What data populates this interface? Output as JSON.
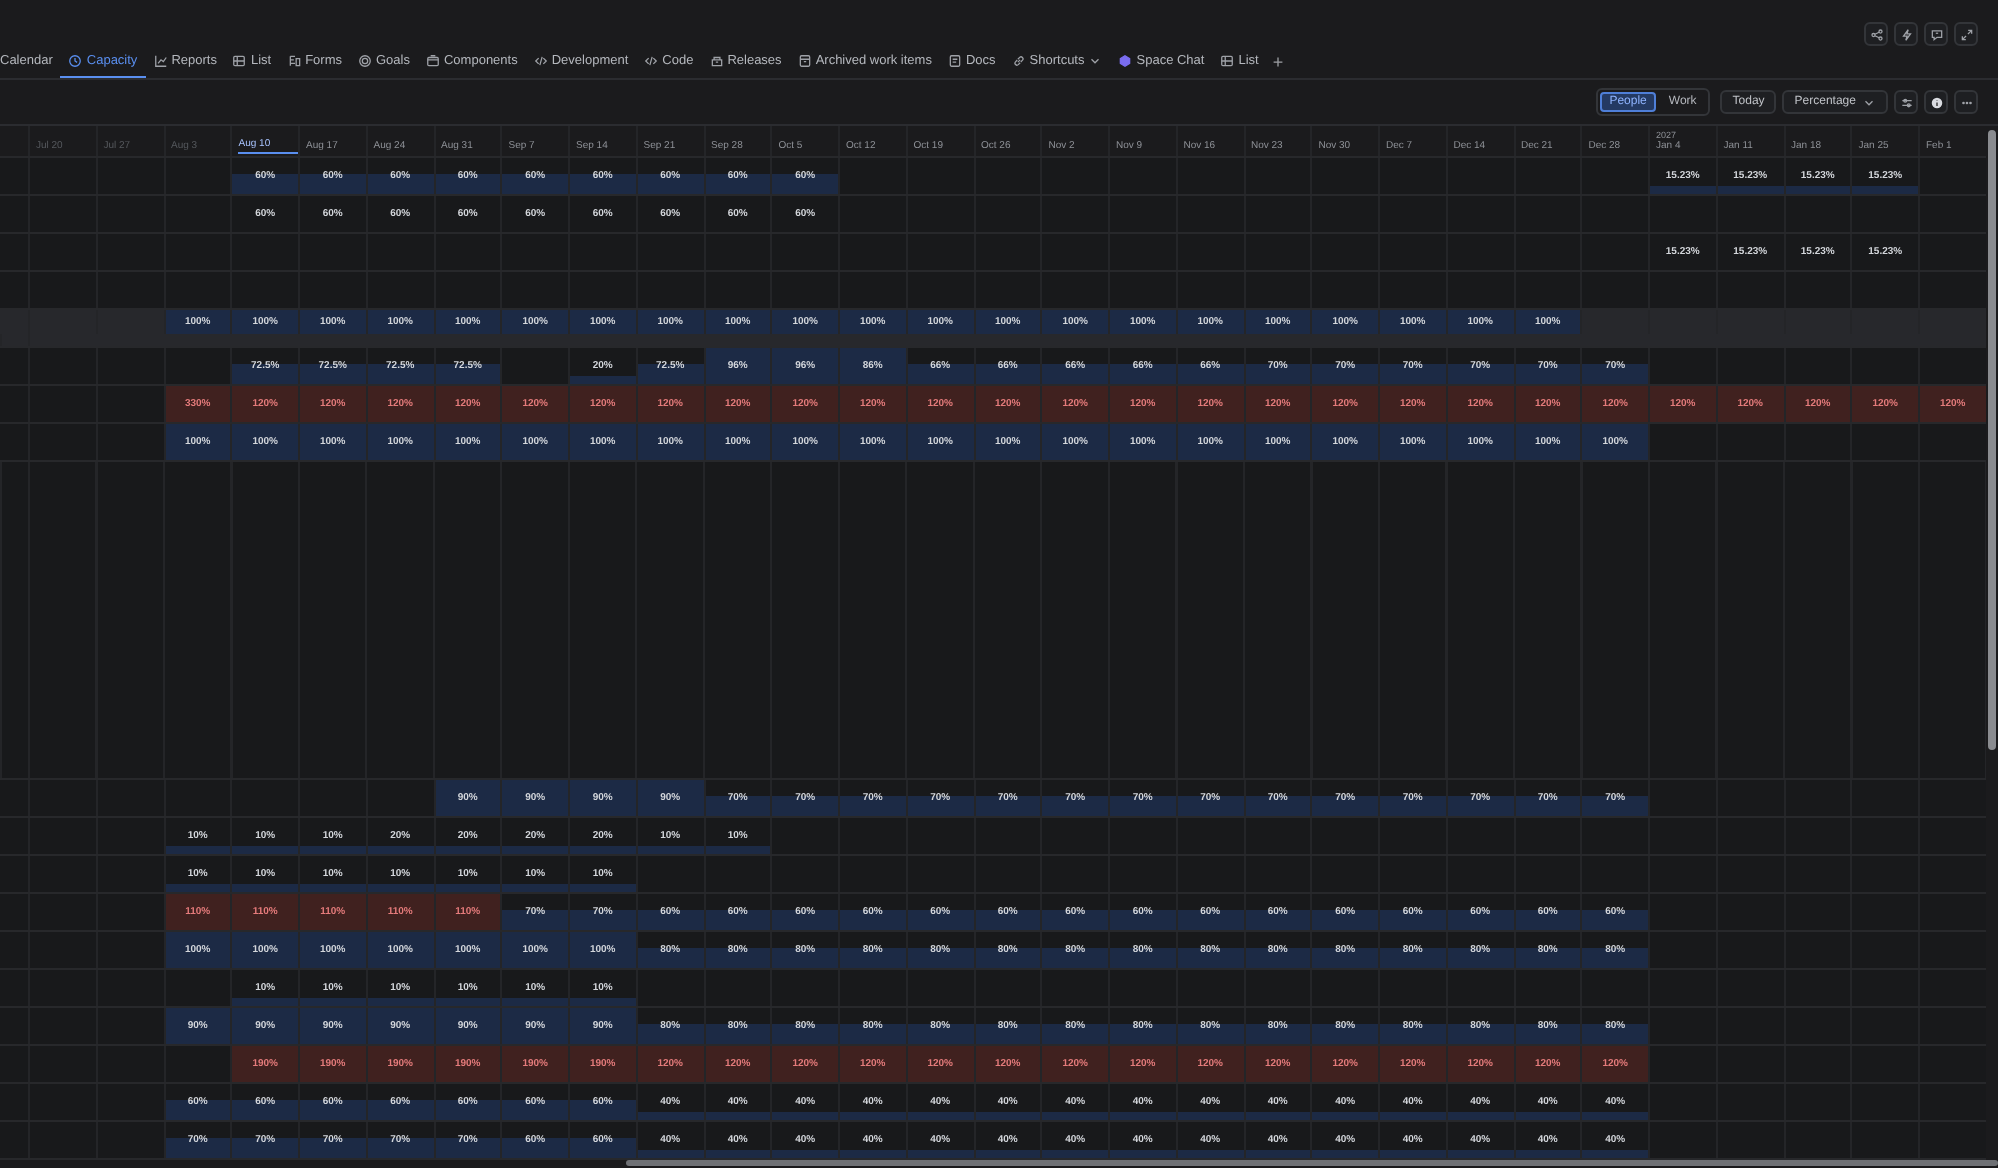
{
  "tabs": [
    {
      "label": "Calendar",
      "kind": "none",
      "selected": false,
      "dropdown": false
    },
    {
      "label": "Capacity",
      "kind": "clock",
      "selected": true,
      "dropdown": false
    },
    {
      "label": "Reports",
      "kind": "chart",
      "selected": false,
      "dropdown": false
    },
    {
      "label": "List",
      "kind": "table",
      "selected": false,
      "dropdown": false
    },
    {
      "label": "Forms",
      "kind": "forms",
      "selected": false,
      "dropdown": false
    },
    {
      "label": "Goals",
      "kind": "target",
      "selected": false,
      "dropdown": false
    },
    {
      "label": "Components",
      "kind": "box",
      "selected": false,
      "dropdown": false
    },
    {
      "label": "Development",
      "kind": "code",
      "selected": false,
      "dropdown": false
    },
    {
      "label": "Code",
      "kind": "code",
      "selected": false,
      "dropdown": false
    },
    {
      "label": "Releases",
      "kind": "package",
      "selected": false,
      "dropdown": false
    },
    {
      "label": "Archived work items",
      "kind": "archive",
      "selected": false,
      "dropdown": false
    },
    {
      "label": "Docs",
      "kind": "doc",
      "selected": false,
      "dropdown": false
    },
    {
      "label": "Shortcuts",
      "kind": "link",
      "selected": false,
      "dropdown": true
    },
    {
      "label": "Space Chat",
      "kind": "chat",
      "selected": false,
      "dropdown": false
    },
    {
      "label": "List",
      "kind": "table",
      "selected": false,
      "dropdown": false
    }
  ],
  "add_tab": "+",
  "toolbar": {
    "view_toggle": [
      {
        "label": "People",
        "selected": true
      },
      {
        "label": "Work",
        "selected": false
      }
    ],
    "today": "Today",
    "unit": "Percentage"
  },
  "weeks": [
    {
      "label": "Jul 20",
      "kind": "past"
    },
    {
      "label": "Jul 27",
      "kind": "past"
    },
    {
      "label": "Aug 3",
      "kind": "past"
    },
    {
      "label": "Aug 10",
      "kind": "current"
    },
    {
      "label": "Aug 17",
      "kind": "future"
    },
    {
      "label": "Aug 24",
      "kind": "future"
    },
    {
      "label": "Aug 31",
      "kind": "future"
    },
    {
      "label": "Sep 7",
      "kind": "future"
    },
    {
      "label": "Sep 14",
      "kind": "future"
    },
    {
      "label": "Sep 21",
      "kind": "future"
    },
    {
      "label": "Sep 28",
      "kind": "future"
    },
    {
      "label": "Oct 5",
      "kind": "future"
    },
    {
      "label": "Oct 12",
      "kind": "future"
    },
    {
      "label": "Oct 19",
      "kind": "future"
    },
    {
      "label": "Oct 26",
      "kind": "future"
    },
    {
      "label": "Nov 2",
      "kind": "future"
    },
    {
      "label": "Nov 9",
      "kind": "future"
    },
    {
      "label": "Nov 16",
      "kind": "future"
    },
    {
      "label": "Nov 23",
      "kind": "future"
    },
    {
      "label": "Nov 30",
      "kind": "future"
    },
    {
      "label": "Dec 7",
      "kind": "future"
    },
    {
      "label": "Dec 14",
      "kind": "future"
    },
    {
      "label": "Dec 21",
      "kind": "future"
    },
    {
      "label": "Dec 28",
      "kind": "future"
    },
    {
      "label": "Jan 4",
      "kind": "future",
      "year": "2027"
    },
    {
      "label": "Jan 11",
      "kind": "future"
    },
    {
      "label": "Jan 18",
      "kind": "future"
    },
    {
      "label": "Jan 25",
      "kind": "future"
    },
    {
      "label": "Feb 1",
      "kind": "future"
    }
  ],
  "upper_rows": [
    {
      "selected": false,
      "cells": [
        null,
        null,
        null,
        {
          "value": "60%",
          "kind": "bar"
        },
        {
          "value": "60%",
          "kind": "bar"
        },
        {
          "value": "60%",
          "kind": "bar"
        },
        {
          "value": "60%",
          "kind": "bar"
        },
        {
          "value": "60%",
          "kind": "bar"
        },
        {
          "value": "60%",
          "kind": "bar"
        },
        {
          "value": "60%",
          "kind": "bar"
        },
        {
          "value": "60%",
          "kind": "bar"
        },
        {
          "value": "60%",
          "kind": "bar"
        },
        null,
        null,
        null,
        null,
        null,
        null,
        null,
        null,
        null,
        null,
        null,
        null,
        {
          "value": "15.23%",
          "kind": "low"
        },
        {
          "value": "15.23%",
          "kind": "low"
        },
        {
          "value": "15.23%",
          "kind": "low"
        },
        {
          "value": "15.23%",
          "kind": "low"
        },
        null
      ]
    },
    {
      "selected": false,
      "cells": [
        null,
        null,
        null,
        {
          "value": "60%",
          "kind": "plain"
        },
        {
          "value": "60%",
          "kind": "plain"
        },
        {
          "value": "60%",
          "kind": "plain"
        },
        {
          "value": "60%",
          "kind": "plain"
        },
        {
          "value": "60%",
          "kind": "plain"
        },
        {
          "value": "60%",
          "kind": "plain"
        },
        {
          "value": "60%",
          "kind": "plain"
        },
        {
          "value": "60%",
          "kind": "plain"
        },
        {
          "value": "60%",
          "kind": "plain"
        },
        null,
        null,
        null,
        null,
        null,
        null,
        null,
        null,
        null,
        null,
        null,
        null,
        null,
        null,
        null,
        null,
        null
      ]
    },
    {
      "selected": false,
      "cells": [
        null,
        null,
        null,
        null,
        null,
        null,
        null,
        null,
        null,
        null,
        null,
        null,
        null,
        null,
        null,
        null,
        null,
        null,
        null,
        null,
        null,
        null,
        null,
        null,
        {
          "value": "15.23%",
          "kind": "plain"
        },
        {
          "value": "15.23%",
          "kind": "plain"
        },
        {
          "value": "15.23%",
          "kind": "plain"
        },
        {
          "value": "15.23%",
          "kind": "plain"
        },
        null
      ]
    },
    {
      "selected": false,
      "cells": [
        null,
        null,
        null,
        null,
        null,
        null,
        null,
        null,
        null,
        null,
        null,
        null,
        null,
        null,
        null,
        null,
        null,
        null,
        null,
        null,
        null,
        null,
        null,
        null,
        null,
        null,
        null,
        null,
        null
      ]
    },
    {
      "selected": true,
      "cells": [
        null,
        null,
        {
          "value": "100%",
          "kind": "full"
        },
        {
          "value": "100%",
          "kind": "full"
        },
        {
          "value": "100%",
          "kind": "full"
        },
        {
          "value": "100%",
          "kind": "full"
        },
        {
          "value": "100%",
          "kind": "full"
        },
        {
          "value": "100%",
          "kind": "full"
        },
        {
          "value": "100%",
          "kind": "full"
        },
        {
          "value": "100%",
          "kind": "full"
        },
        {
          "value": "100%",
          "kind": "full"
        },
        {
          "value": "100%",
          "kind": "full"
        },
        {
          "value": "100%",
          "kind": "full"
        },
        {
          "value": "100%",
          "kind": "full"
        },
        {
          "value": "100%",
          "kind": "full"
        },
        {
          "value": "100%",
          "kind": "full"
        },
        {
          "value": "100%",
          "kind": "full"
        },
        {
          "value": "100%",
          "kind": "full"
        },
        {
          "value": "100%",
          "kind": "full"
        },
        {
          "value": "100%",
          "kind": "full"
        },
        {
          "value": "100%",
          "kind": "full"
        },
        {
          "value": "100%",
          "kind": "full"
        },
        {
          "value": "100%",
          "kind": "full"
        },
        null,
        null,
        null,
        null,
        null,
        null,
        null,
        null
      ]
    },
    {
      "selected": false,
      "cells": [
        null,
        null,
        null,
        {
          "value": "72.5%",
          "kind": "bar"
        },
        {
          "value": "72.5%",
          "kind": "bar"
        },
        {
          "value": "72.5%",
          "kind": "bar"
        },
        {
          "value": "72.5%",
          "kind": "bar"
        },
        null,
        {
          "value": "20%",
          "kind": "low"
        },
        {
          "value": "72.5%",
          "kind": "bar"
        },
        {
          "value": "96%",
          "kind": "full"
        },
        {
          "value": "96%",
          "kind": "full"
        },
        {
          "value": "86%",
          "kind": "full"
        },
        {
          "value": "66%",
          "kind": "bar"
        },
        {
          "value": "66%",
          "kind": "bar"
        },
        {
          "value": "66%",
          "kind": "bar"
        },
        {
          "value": "66%",
          "kind": "bar"
        },
        {
          "value": "66%",
          "kind": "bar"
        },
        {
          "value": "70%",
          "kind": "bar"
        },
        {
          "value": "70%",
          "kind": "bar"
        },
        {
          "value": "70%",
          "kind": "bar"
        },
        {
          "value": "70%",
          "kind": "bar"
        },
        {
          "value": "70%",
          "kind": "bar"
        },
        {
          "value": "70%",
          "kind": "bar"
        },
        null,
        null,
        null,
        null,
        null
      ]
    },
    {
      "selected": false,
      "cells": [
        null,
        null,
        {
          "value": "330%",
          "kind": "over"
        },
        {
          "value": "120%",
          "kind": "over"
        },
        {
          "value": "120%",
          "kind": "over"
        },
        {
          "value": "120%",
          "kind": "over"
        },
        {
          "value": "120%",
          "kind": "over"
        },
        {
          "value": "120%",
          "kind": "over"
        },
        {
          "value": "120%",
          "kind": "over"
        },
        {
          "value": "120%",
          "kind": "over"
        },
        {
          "value": "120%",
          "kind": "over"
        },
        {
          "value": "120%",
          "kind": "over"
        },
        {
          "value": "120%",
          "kind": "over"
        },
        {
          "value": "120%",
          "kind": "over"
        },
        {
          "value": "120%",
          "kind": "over"
        },
        {
          "value": "120%",
          "kind": "over"
        },
        {
          "value": "120%",
          "kind": "over"
        },
        {
          "value": "120%",
          "kind": "over"
        },
        {
          "value": "120%",
          "kind": "over"
        },
        {
          "value": "120%",
          "kind": "over"
        },
        {
          "value": "120%",
          "kind": "over"
        },
        {
          "value": "120%",
          "kind": "over"
        },
        {
          "value": "120%",
          "kind": "over"
        },
        {
          "value": "120%",
          "kind": "over"
        },
        {
          "value": "120%",
          "kind": "over"
        },
        {
          "value": "120%",
          "kind": "over"
        },
        {
          "value": "120%",
          "kind": "over"
        },
        {
          "value": "120%",
          "kind": "over"
        },
        {
          "value": "120%",
          "kind": "over"
        }
      ]
    },
    {
      "selected": false,
      "cells": [
        null,
        null,
        {
          "value": "100%",
          "kind": "full"
        },
        {
          "value": "100%",
          "kind": "full"
        },
        {
          "value": "100%",
          "kind": "full"
        },
        {
          "value": "100%",
          "kind": "full"
        },
        {
          "value": "100%",
          "kind": "full"
        },
        {
          "value": "100%",
          "kind": "full"
        },
        {
          "value": "100%",
          "kind": "full"
        },
        {
          "value": "100%",
          "kind": "full"
        },
        {
          "value": "100%",
          "kind": "full"
        },
        {
          "value": "100%",
          "kind": "full"
        },
        {
          "value": "100%",
          "kind": "full"
        },
        {
          "value": "100%",
          "kind": "full"
        },
        {
          "value": "100%",
          "kind": "full"
        },
        {
          "value": "100%",
          "kind": "full"
        },
        {
          "value": "100%",
          "kind": "full"
        },
        {
          "value": "100%",
          "kind": "full"
        },
        {
          "value": "100%",
          "kind": "full"
        },
        {
          "value": "100%",
          "kind": "full"
        },
        {
          "value": "100%",
          "kind": "full"
        },
        {
          "value": "100%",
          "kind": "full"
        },
        {
          "value": "100%",
          "kind": "full"
        },
        {
          "value": "100%",
          "kind": "full"
        },
        null,
        null,
        null,
        null,
        null
      ]
    }
  ],
  "lower_rows": [
    {
      "selected": false,
      "cells": [
        null,
        null,
        null,
        null,
        null,
        null,
        {
          "value": "90%",
          "kind": "full"
        },
        {
          "value": "90%",
          "kind": "full"
        },
        {
          "value": "90%",
          "kind": "full"
        },
        {
          "value": "90%",
          "kind": "full"
        },
        {
          "value": "70%",
          "kind": "bar"
        },
        {
          "value": "70%",
          "kind": "bar"
        },
        {
          "value": "70%",
          "kind": "bar"
        },
        {
          "value": "70%",
          "kind": "bar"
        },
        {
          "value": "70%",
          "kind": "bar"
        },
        {
          "value": "70%",
          "kind": "bar"
        },
        {
          "value": "70%",
          "kind": "bar"
        },
        {
          "value": "70%",
          "kind": "bar"
        },
        {
          "value": "70%",
          "kind": "bar"
        },
        {
          "value": "70%",
          "kind": "bar"
        },
        {
          "value": "70%",
          "kind": "bar"
        },
        {
          "value": "70%",
          "kind": "bar"
        },
        {
          "value": "70%",
          "kind": "bar"
        },
        {
          "value": "70%",
          "kind": "bar"
        },
        null,
        null,
        null,
        null,
        null
      ]
    },
    {
      "selected": false,
      "cells": [
        null,
        null,
        {
          "value": "10%",
          "kind": "low"
        },
        {
          "value": "10%",
          "kind": "low"
        },
        {
          "value": "10%",
          "kind": "low"
        },
        {
          "value": "20%",
          "kind": "low"
        },
        {
          "value": "20%",
          "kind": "low"
        },
        {
          "value": "20%",
          "kind": "low"
        },
        {
          "value": "20%",
          "kind": "low"
        },
        {
          "value": "10%",
          "kind": "low"
        },
        {
          "value": "10%",
          "kind": "low"
        },
        null,
        null,
        null,
        null,
        null,
        null,
        null,
        null,
        null,
        null,
        null,
        null,
        null,
        null,
        null,
        null,
        null,
        null
      ]
    },
    {
      "selected": false,
      "cells": [
        null,
        null,
        {
          "value": "10%",
          "kind": "low"
        },
        {
          "value": "10%",
          "kind": "low"
        },
        {
          "value": "10%",
          "kind": "low"
        },
        {
          "value": "10%",
          "kind": "low"
        },
        {
          "value": "10%",
          "kind": "low"
        },
        {
          "value": "10%",
          "kind": "low"
        },
        {
          "value": "10%",
          "kind": "low"
        },
        null,
        null,
        null,
        null,
        null,
        null,
        null,
        null,
        null,
        null,
        null,
        null,
        null,
        null,
        null,
        null,
        null,
        null,
        null,
        null
      ]
    },
    {
      "selected": false,
      "cells": [
        null,
        null,
        {
          "value": "110%",
          "kind": "over"
        },
        {
          "value": "110%",
          "kind": "over"
        },
        {
          "value": "110%",
          "kind": "over"
        },
        {
          "value": "110%",
          "kind": "over"
        },
        {
          "value": "110%",
          "kind": "over"
        },
        {
          "value": "70%",
          "kind": "bar"
        },
        {
          "value": "70%",
          "kind": "bar"
        },
        {
          "value": "60%",
          "kind": "bar"
        },
        {
          "value": "60%",
          "kind": "bar"
        },
        {
          "value": "60%",
          "kind": "bar"
        },
        {
          "value": "60%",
          "kind": "bar"
        },
        {
          "value": "60%",
          "kind": "bar"
        },
        {
          "value": "60%",
          "kind": "bar"
        },
        {
          "value": "60%",
          "kind": "bar"
        },
        {
          "value": "60%",
          "kind": "bar"
        },
        {
          "value": "60%",
          "kind": "bar"
        },
        {
          "value": "60%",
          "kind": "bar"
        },
        {
          "value": "60%",
          "kind": "bar"
        },
        {
          "value": "60%",
          "kind": "bar"
        },
        {
          "value": "60%",
          "kind": "bar"
        },
        {
          "value": "60%",
          "kind": "bar"
        },
        {
          "value": "60%",
          "kind": "bar"
        },
        null,
        null,
        null,
        null,
        null
      ]
    },
    {
      "selected": false,
      "cells": [
        null,
        null,
        {
          "value": "100%",
          "kind": "full"
        },
        {
          "value": "100%",
          "kind": "full"
        },
        {
          "value": "100%",
          "kind": "full"
        },
        {
          "value": "100%",
          "kind": "full"
        },
        {
          "value": "100%",
          "kind": "full"
        },
        {
          "value": "100%",
          "kind": "full"
        },
        {
          "value": "100%",
          "kind": "full"
        },
        {
          "value": "80%",
          "kind": "bar"
        },
        {
          "value": "80%",
          "kind": "bar"
        },
        {
          "value": "80%",
          "kind": "bar"
        },
        {
          "value": "80%",
          "kind": "bar"
        },
        {
          "value": "80%",
          "kind": "bar"
        },
        {
          "value": "80%",
          "kind": "bar"
        },
        {
          "value": "80%",
          "kind": "bar"
        },
        {
          "value": "80%",
          "kind": "bar"
        },
        {
          "value": "80%",
          "kind": "bar"
        },
        {
          "value": "80%",
          "kind": "bar"
        },
        {
          "value": "80%",
          "kind": "bar"
        },
        {
          "value": "80%",
          "kind": "bar"
        },
        {
          "value": "80%",
          "kind": "bar"
        },
        {
          "value": "80%",
          "kind": "bar"
        },
        {
          "value": "80%",
          "kind": "bar"
        },
        null,
        null,
        null,
        null,
        null
      ]
    },
    {
      "selected": false,
      "cells": [
        null,
        null,
        null,
        {
          "value": "10%",
          "kind": "low"
        },
        {
          "value": "10%",
          "kind": "low"
        },
        {
          "value": "10%",
          "kind": "low"
        },
        {
          "value": "10%",
          "kind": "low"
        },
        {
          "value": "10%",
          "kind": "low"
        },
        {
          "value": "10%",
          "kind": "low"
        },
        null,
        null,
        null,
        null,
        null,
        null,
        null,
        null,
        null,
        null,
        null,
        null,
        null,
        null,
        null,
        null,
        null,
        null,
        null,
        null
      ]
    },
    {
      "selected": false,
      "cells": [
        null,
        null,
        {
          "value": "90%",
          "kind": "full"
        },
        {
          "value": "90%",
          "kind": "full"
        },
        {
          "value": "90%",
          "kind": "full"
        },
        {
          "value": "90%",
          "kind": "full"
        },
        {
          "value": "90%",
          "kind": "full"
        },
        {
          "value": "90%",
          "kind": "full"
        },
        {
          "value": "90%",
          "kind": "full"
        },
        {
          "value": "80%",
          "kind": "bar"
        },
        {
          "value": "80%",
          "kind": "bar"
        },
        {
          "value": "80%",
          "kind": "bar"
        },
        {
          "value": "80%",
          "kind": "bar"
        },
        {
          "value": "80%",
          "kind": "bar"
        },
        {
          "value": "80%",
          "kind": "bar"
        },
        {
          "value": "80%",
          "kind": "bar"
        },
        {
          "value": "80%",
          "kind": "bar"
        },
        {
          "value": "80%",
          "kind": "bar"
        },
        {
          "value": "80%",
          "kind": "bar"
        },
        {
          "value": "80%",
          "kind": "bar"
        },
        {
          "value": "80%",
          "kind": "bar"
        },
        {
          "value": "80%",
          "kind": "bar"
        },
        {
          "value": "80%",
          "kind": "bar"
        },
        {
          "value": "80%",
          "kind": "bar"
        },
        null,
        null,
        null,
        null,
        null
      ]
    },
    {
      "selected": false,
      "cells": [
        null,
        null,
        null,
        {
          "value": "190%",
          "kind": "over"
        },
        {
          "value": "190%",
          "kind": "over"
        },
        {
          "value": "190%",
          "kind": "over"
        },
        {
          "value": "190%",
          "kind": "over"
        },
        {
          "value": "190%",
          "kind": "over"
        },
        {
          "value": "190%",
          "kind": "over"
        },
        {
          "value": "120%",
          "kind": "over"
        },
        {
          "value": "120%",
          "kind": "over"
        },
        {
          "value": "120%",
          "kind": "over"
        },
        {
          "value": "120%",
          "kind": "over"
        },
        {
          "value": "120%",
          "kind": "over"
        },
        {
          "value": "120%",
          "kind": "over"
        },
        {
          "value": "120%",
          "kind": "over"
        },
        {
          "value": "120%",
          "kind": "over"
        },
        {
          "value": "120%",
          "kind": "over"
        },
        {
          "value": "120%",
          "kind": "over"
        },
        {
          "value": "120%",
          "kind": "over"
        },
        {
          "value": "120%",
          "kind": "over"
        },
        {
          "value": "120%",
          "kind": "over"
        },
        {
          "value": "120%",
          "kind": "over"
        },
        {
          "value": "120%",
          "kind": "over"
        },
        null,
        null,
        null,
        null,
        null
      ]
    },
    {
      "selected": false,
      "cells": [
        null,
        null,
        {
          "value": "60%",
          "kind": "bar"
        },
        {
          "value": "60%",
          "kind": "bar"
        },
        {
          "value": "60%",
          "kind": "bar"
        },
        {
          "value": "60%",
          "kind": "bar"
        },
        {
          "value": "60%",
          "kind": "bar"
        },
        {
          "value": "60%",
          "kind": "bar"
        },
        {
          "value": "60%",
          "kind": "bar"
        },
        {
          "value": "40%",
          "kind": "low"
        },
        {
          "value": "40%",
          "kind": "low"
        },
        {
          "value": "40%",
          "kind": "low"
        },
        {
          "value": "40%",
          "kind": "low"
        },
        {
          "value": "40%",
          "kind": "low"
        },
        {
          "value": "40%",
          "kind": "low"
        },
        {
          "value": "40%",
          "kind": "low"
        },
        {
          "value": "40%",
          "kind": "low"
        },
        {
          "value": "40%",
          "kind": "low"
        },
        {
          "value": "40%",
          "kind": "low"
        },
        {
          "value": "40%",
          "kind": "low"
        },
        {
          "value": "40%",
          "kind": "low"
        },
        {
          "value": "40%",
          "kind": "low"
        },
        {
          "value": "40%",
          "kind": "low"
        },
        {
          "value": "40%",
          "kind": "low"
        },
        null,
        null,
        null,
        null,
        null
      ]
    },
    {
      "selected": false,
      "cells": [
        null,
        null,
        {
          "value": "70%",
          "kind": "bar"
        },
        {
          "value": "70%",
          "kind": "bar"
        },
        {
          "value": "70%",
          "kind": "bar"
        },
        {
          "value": "70%",
          "kind": "bar"
        },
        {
          "value": "70%",
          "kind": "bar"
        },
        {
          "value": "60%",
          "kind": "bar"
        },
        {
          "value": "60%",
          "kind": "bar"
        },
        {
          "value": "40%",
          "kind": "low"
        },
        {
          "value": "40%",
          "kind": "low"
        },
        {
          "value": "40%",
          "kind": "low"
        },
        {
          "value": "40%",
          "kind": "low"
        },
        {
          "value": "40%",
          "kind": "low"
        },
        {
          "value": "40%",
          "kind": "low"
        },
        {
          "value": "40%",
          "kind": "low"
        },
        {
          "value": "40%",
          "kind": "low"
        },
        {
          "value": "40%",
          "kind": "low"
        },
        {
          "value": "40%",
          "kind": "low"
        },
        {
          "value": "40%",
          "kind": "low"
        },
        {
          "value": "40%",
          "kind": "low"
        },
        {
          "value": "40%",
          "kind": "low"
        },
        {
          "value": "40%",
          "kind": "low"
        },
        {
          "value": "40%",
          "kind": "low"
        },
        null,
        null,
        null,
        null,
        null
      ]
    }
  ]
}
